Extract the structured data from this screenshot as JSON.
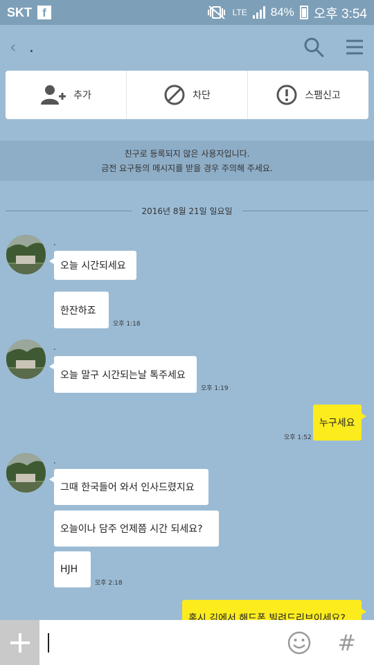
{
  "status_bar": {
    "carrier": "SKT",
    "fb_badge": "f",
    "network": "LTE",
    "battery": "84%",
    "time": "오후 3:54"
  },
  "header": {
    "title": "."
  },
  "actions": [
    {
      "label": "추가",
      "icon": "add-friend-icon"
    },
    {
      "label": "차단",
      "icon": "block-icon"
    },
    {
      "label": "스팸신고",
      "icon": "report-icon"
    }
  ],
  "notice": {
    "line1": "친구로 등록되지 않은 사용자입니다.",
    "line2": "금전 요구등의 메시지를 받을 경우 주의해 주세요."
  },
  "date_divider": "2016년 8월 21일 일요일",
  "groups": [
    {
      "sender": ".",
      "messages": [
        "오늘 시간되세요",
        "한잔하죠"
      ],
      "time": "오후 1:18"
    },
    {
      "sender": ".",
      "messages": [
        "오늘 말구 시간되는날 톡주세요"
      ],
      "time": "오후 1:19"
    },
    {
      "sender": ".",
      "messages": [
        "그때 한국들어 와서 인사드렸지요",
        "오늘이나 담주 언제쯤 시간 되세요?",
        "HJH"
      ],
      "time": "오후 2:18"
    }
  ],
  "my_messages": [
    {
      "text": "누구세요",
      "time": "오후 1:52"
    },
    {
      "text": "혹시 김에서 해드폰 빌려드리브이세요?"
    }
  ],
  "input": {
    "value": ""
  },
  "colors": {
    "background": "#9bbbd4",
    "my_bubble": "#fcec1e",
    "status_bar": "#7e9fb8"
  }
}
